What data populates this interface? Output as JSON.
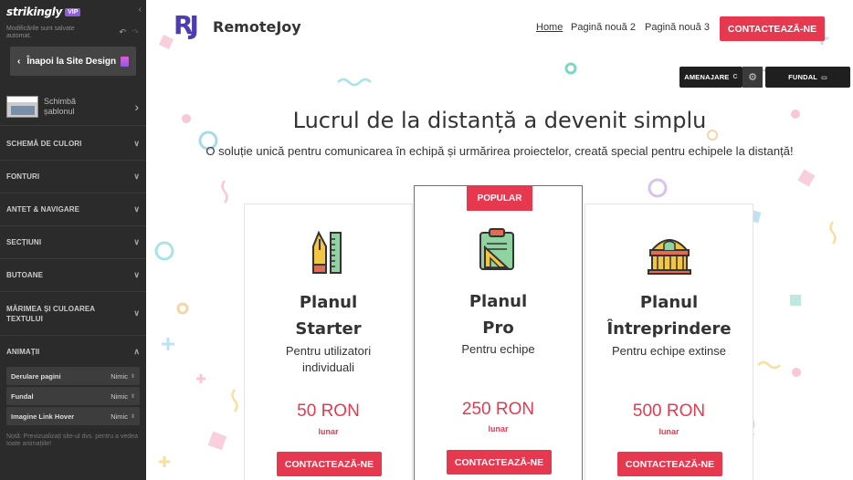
{
  "sidebar": {
    "brand": "strikingly",
    "vip_badge": "VIP",
    "saved_status": "Modificările sunt salvate automat.",
    "back_button": "Înapoi la Site Design",
    "change_template": "Schimbă șablonul",
    "sections": [
      {
        "label": "SCHEMĂ DE CULORI"
      },
      {
        "label": "FONTURI"
      },
      {
        "label": "ANTET & NAVIGARE"
      },
      {
        "label": "SECȚIUNI"
      },
      {
        "label": "BUTOANE"
      },
      {
        "label": "MĂRIMEA ȘI CULOAREA TEXTULUI"
      },
      {
        "label": "ANIMAȚII"
      }
    ],
    "animation_settings": [
      {
        "label": "Derulare pagini",
        "value": "Nimic"
      },
      {
        "label": "Fundal",
        "value": "Nimic"
      },
      {
        "label": "Imagine Link Hover",
        "value": "Nimic"
      }
    ],
    "note": "Notă: Previzualizați site-ul dvs. pentru a vedea toate animațiile!"
  },
  "site": {
    "logo_mark": "RJ",
    "logo_text": "RemoteJoy",
    "nav": [
      {
        "label": "Home",
        "active": true
      },
      {
        "label": "Pagină nouă 2",
        "active": false
      },
      {
        "label": "Pagină nouă 3",
        "active": false
      }
    ],
    "nav_cta": "CONTACTEAZĂ-NE",
    "editor_tools": {
      "layout": "AMENAJARE",
      "layout_icon": "C",
      "background": "FUNDAL"
    },
    "hero_title": "Lucrul de la distanță a devenit simplu",
    "hero_subtitle": "O soluție unică pentru comunicarea în echipă și urmărirea proiectelor, creată special pentru echipele la distanță!",
    "plans": [
      {
        "name_line1": "Planul",
        "name_line2": "Starter",
        "description": "Pentru utilizatori individuali",
        "price": "50 RON",
        "period": "lunar",
        "button": "CONTACTEAZĂ-NE",
        "icon": "pen-ruler-icon"
      },
      {
        "badge": "POPULAR",
        "name_line1": "Planul",
        "name_line2": "Pro",
        "description": "Pentru echipe",
        "price": "250 RON",
        "period": "lunar",
        "button": "CONTACTEAZĂ-NE",
        "icon": "clipboard-ruler-icon"
      },
      {
        "name_line1": "Planul",
        "name_line2": "Întreprindere",
        "description": "Pentru echipe extinse",
        "price": "500 RON",
        "period": "lunar",
        "button": "CONTACTEAZĂ-NE",
        "icon": "building-icon"
      }
    ]
  },
  "colors": {
    "accent": "#e63950",
    "brand": "#4d3db0",
    "sidebar_bg": "#2b2b2b"
  }
}
